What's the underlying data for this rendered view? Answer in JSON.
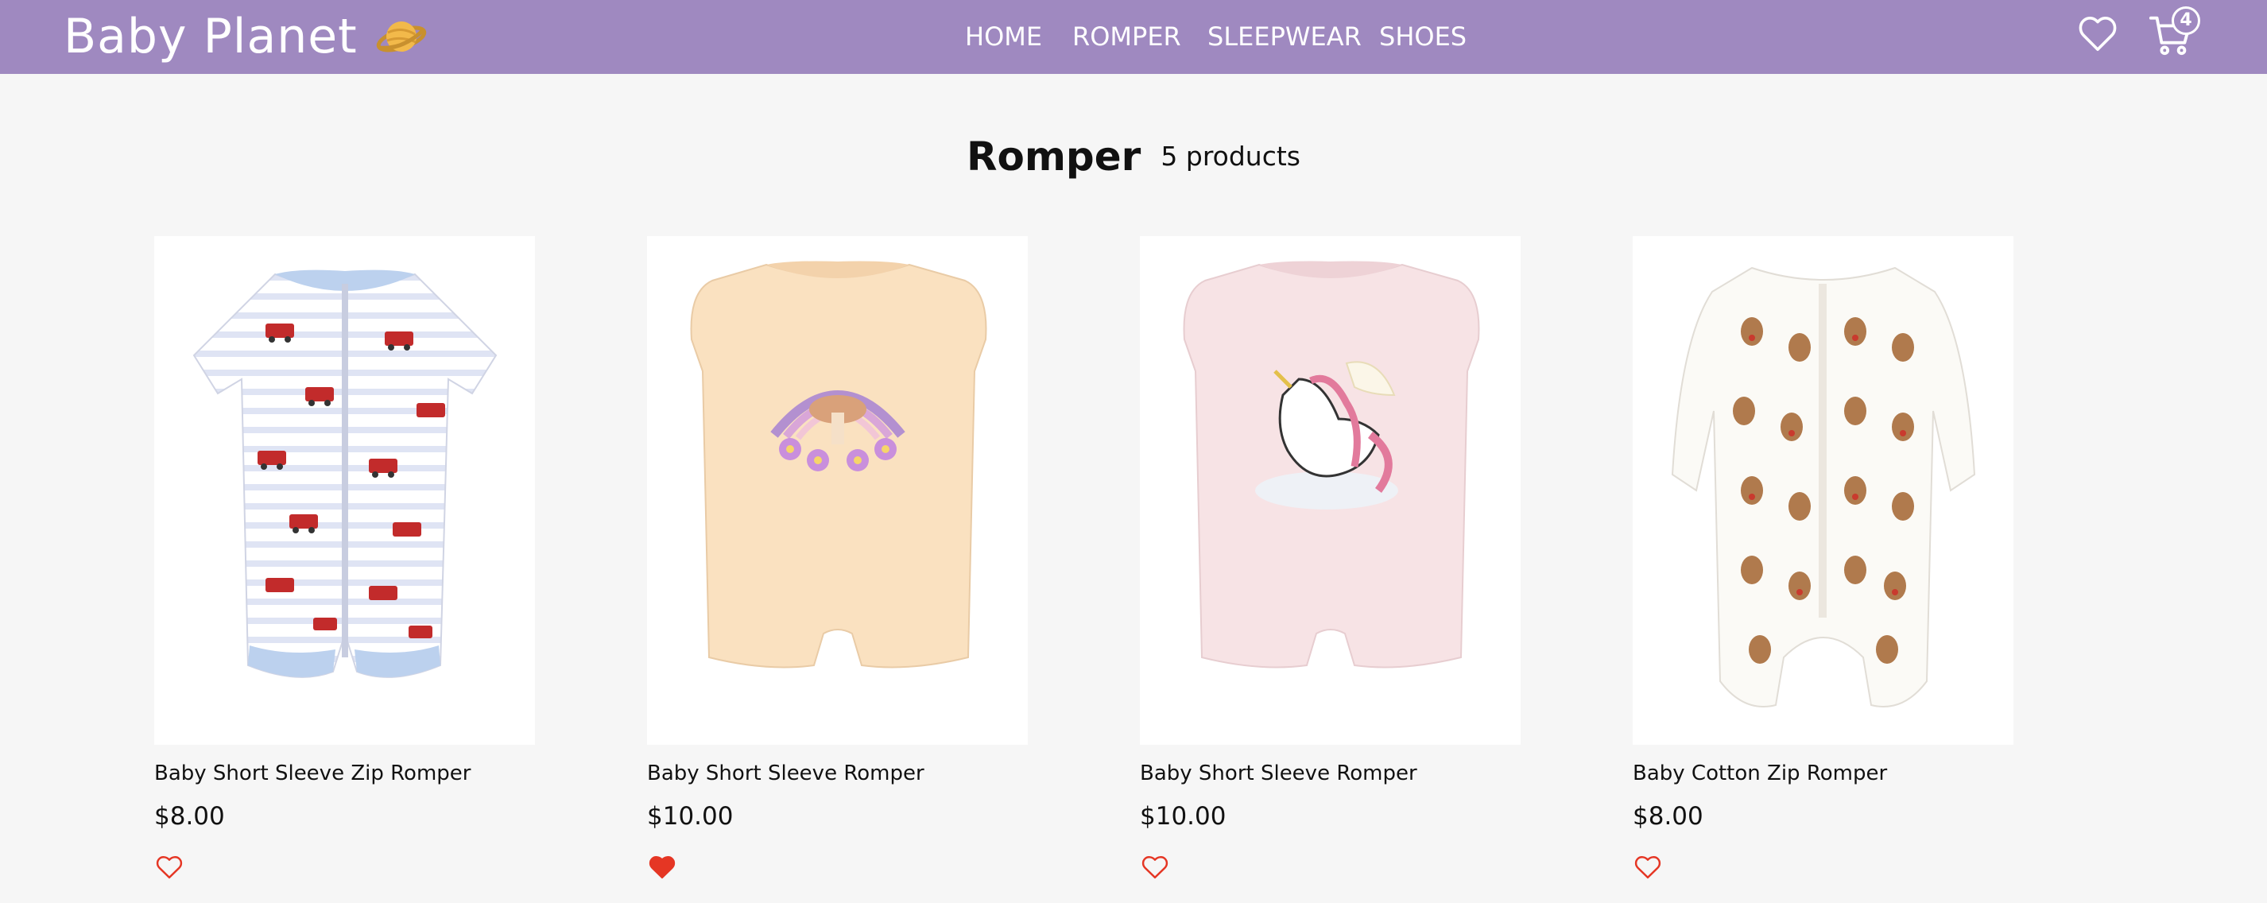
{
  "header": {
    "logo_text": "Baby Planet",
    "nav": [
      {
        "label": "HOME"
      },
      {
        "label": "ROMPER"
      },
      {
        "label": "SLEEPWEAR"
      },
      {
        "label": "SHOES"
      }
    ],
    "cart_count": "4",
    "icons": {
      "logo": "planet-icon",
      "wishlist": "heart-outline-icon",
      "cart": "cart-icon"
    },
    "brand_color": "#9f89c0"
  },
  "page": {
    "title": "Romper",
    "count": "5 products"
  },
  "products": [
    {
      "name": "Baby Short Sleeve Zip Romper",
      "price": "$8.00",
      "favorited": false
    },
    {
      "name": "Baby Short Sleeve Romper",
      "price": "$10.00",
      "favorited": true
    },
    {
      "name": "Baby Short Sleeve Romper",
      "price": "$10.00",
      "favorited": false
    },
    {
      "name": "Baby Cotton Zip Romper",
      "price": "$8.00",
      "favorited": false
    }
  ],
  "colors": {
    "heart": "#e53624",
    "background": "#f6f6f6"
  }
}
